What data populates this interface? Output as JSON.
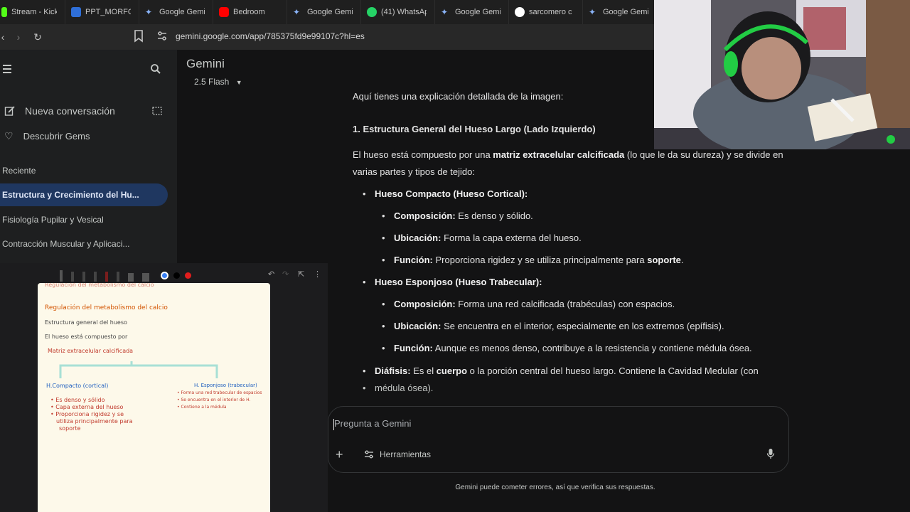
{
  "browser": {
    "tabs": [
      {
        "label": "Stream - Kick",
        "color": "#53fc18"
      },
      {
        "label": "PPT_MORFO",
        "color": "#2f6fd8"
      },
      {
        "label": "Google Gemi",
        "color": "#8ab4f8"
      },
      {
        "label": "Bedroom",
        "color": "#ff0000"
      },
      {
        "label": "Google Gemi",
        "color": "#8ab4f8"
      },
      {
        "label": "(41) WhatsAp",
        "color": "#25d366"
      },
      {
        "label": "Google Gemi",
        "color": "#8ab4f8"
      },
      {
        "label": "sarcomero c",
        "color": "#ffffff"
      },
      {
        "label": "Google Gemi",
        "color": "#8ab4f8"
      }
    ],
    "url": "gemini.google.com/app/785375fd9e99107c?hl=es"
  },
  "sidebar": {
    "new_chat": "Nueva conversación",
    "discover": "Descubrir Gems",
    "recent_title": "Reciente",
    "recent": [
      "Estructura y Crecimiento del Hu...",
      "Fisiología Pupilar y Vesical",
      "Contracción Muscular y Aplicaci..."
    ]
  },
  "header": {
    "title": "Gemini",
    "model": "2.5 Flash"
  },
  "content": {
    "intro": "Aquí tienes una explicación detallada de la imagen:",
    "heading": "1. Estructura General del Hueso Largo (Lado Izquierdo)",
    "para_a": "El hueso está compuesto por una ",
    "para_b": "matriz extracelular calcificada",
    "para_c": " (lo que le da su dureza) y se divide en varias partes y tipos de tejido:",
    "compact_title": "Hueso Compacto (Hueso Cortical):",
    "compact": [
      {
        "label": "Composición:",
        "text": " Es denso y sólido."
      },
      {
        "label": "Ubicación:",
        "text": " Forma la capa externa del hueso."
      },
      {
        "label": "Función:",
        "text": " Proporciona rigidez y se utiliza principalmente para ",
        "bold_tail": "soporte",
        "tail": "."
      }
    ],
    "spongy_title": "Hueso Esponjoso (Hueso Trabecular):",
    "spongy": [
      {
        "label": "Composición:",
        "text": " Forma una red calcificada (trabéculas) con espacios."
      },
      {
        "label": "Ubicación:",
        "text": " Se encuentra en el interior, especialmente en los extremos (epífisis)."
      },
      {
        "label": "Función:",
        "text": " Aunque es menos denso, contribuye a la resistencia y contiene médula ósea."
      }
    ],
    "diaphysis_label": "Diáfisis:",
    "diaphysis_a": " Es el ",
    "diaphysis_b": "cuerpo",
    "diaphysis_c": " o la porción central del hueso largo. Contiene la Cavidad Medular (con",
    "diaphysis_d": "médula ósea)."
  },
  "input": {
    "placeholder": "Pregunta a Gemini",
    "tools": "Herramientas"
  },
  "disclaimer": "Gemini puede cometer errores, así que verifica sus respuestas.",
  "notes": {
    "lines": [
      "Regulación del metabolismo del calcio",
      "Estructura general del hueso",
      "El hueso está compuesto por",
      "Matriz extracelular calcificada",
      "H.Compacto (cortical)",
      "• Es denso y sólido",
      "• Capa externa del hueso",
      "• Proporciona rigidez y se",
      "utiliza principalmente para",
      "soporte",
      "H. Esponjoso (trabecular)",
      "• Forma una red trabecular de espacios",
      "• Se encuentra en el interior de H.",
      "• Contiene a la médula"
    ]
  }
}
